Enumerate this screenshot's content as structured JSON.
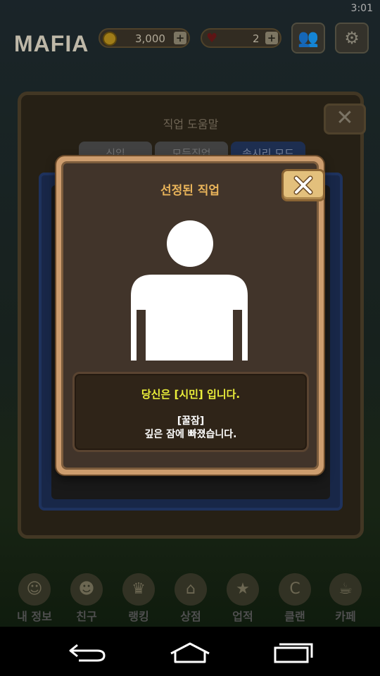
{
  "status_bar": {
    "time": "3:01"
  },
  "top_bar": {
    "logo": "MAFIA",
    "gold": "3,000",
    "gold_plus": "+",
    "hearts": "2",
    "hearts_plus": "+"
  },
  "helper": {
    "title": "직업 도움말",
    "tabs": [
      "신입",
      "모든직업",
      "속시리 모드"
    ]
  },
  "dialog": {
    "title": "선정된 직업",
    "role_message": "당신은 [시민] 입니다.",
    "tip_title": "[꿀잠]",
    "tip_text": "깊은 잠에 빠졌습니다."
  },
  "bottom_nav": [
    {
      "label": "내 정보",
      "icon": "profile-icon"
    },
    {
      "label": "친구",
      "icon": "friends-icon"
    },
    {
      "label": "랭킹",
      "icon": "ranking-icon"
    },
    {
      "label": "상점",
      "icon": "shop-icon"
    },
    {
      "label": "업적",
      "icon": "achievement-icon"
    },
    {
      "label": "클랜",
      "icon": "clan-icon"
    },
    {
      "label": "카페",
      "icon": "cafe-icon"
    }
  ],
  "colors": {
    "dialog_title": "#e9b45a",
    "role_message": "#ecf03b",
    "dialog_frame": "#cd9d6e",
    "dialog_body": "#41342a"
  }
}
